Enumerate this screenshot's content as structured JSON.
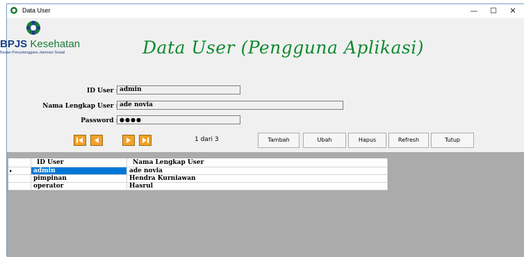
{
  "window": {
    "title": "Data User",
    "minimize": "—",
    "maximize": "☐",
    "close": "✕"
  },
  "logo": {
    "brand_bold": "BPJS",
    "brand_rest": " Kesehatan",
    "subtitle": "Badan Penyelenggara Jaminan Sosial",
    "colors": {
      "green": "#1a7a3a",
      "blue": "#1a3f88"
    }
  },
  "heading": "Data User (Pengguna Aplikasi)",
  "form": {
    "id_user_label": "ID User :",
    "id_user_value": "admin",
    "nama_label": "Nama Lengkap User :",
    "nama_value": "ade novia",
    "password_label": "Password :",
    "password_value": "●●●●"
  },
  "pager": {
    "text": "1 dari 3"
  },
  "buttons": {
    "tambah": "Tambah",
    "ubah": "Ubah",
    "hapus": "Hapus",
    "refresh": "Refresh",
    "tutup": "Tutup"
  },
  "table": {
    "columns": [
      "ID User",
      "Nama Lengkap User"
    ],
    "rows": [
      {
        "id": "admin",
        "nama": "ade novia"
      },
      {
        "id": "pimpinan",
        "nama": "Hendra Kurniawan"
      },
      {
        "id": "operator",
        "nama": "Hasrul"
      }
    ],
    "row_indicator": "▸"
  },
  "colors": {
    "heading": "#0e8a2f",
    "nav_button": "#f2a12a",
    "selection": "#0078d7",
    "grid_bg": "#ababab"
  }
}
